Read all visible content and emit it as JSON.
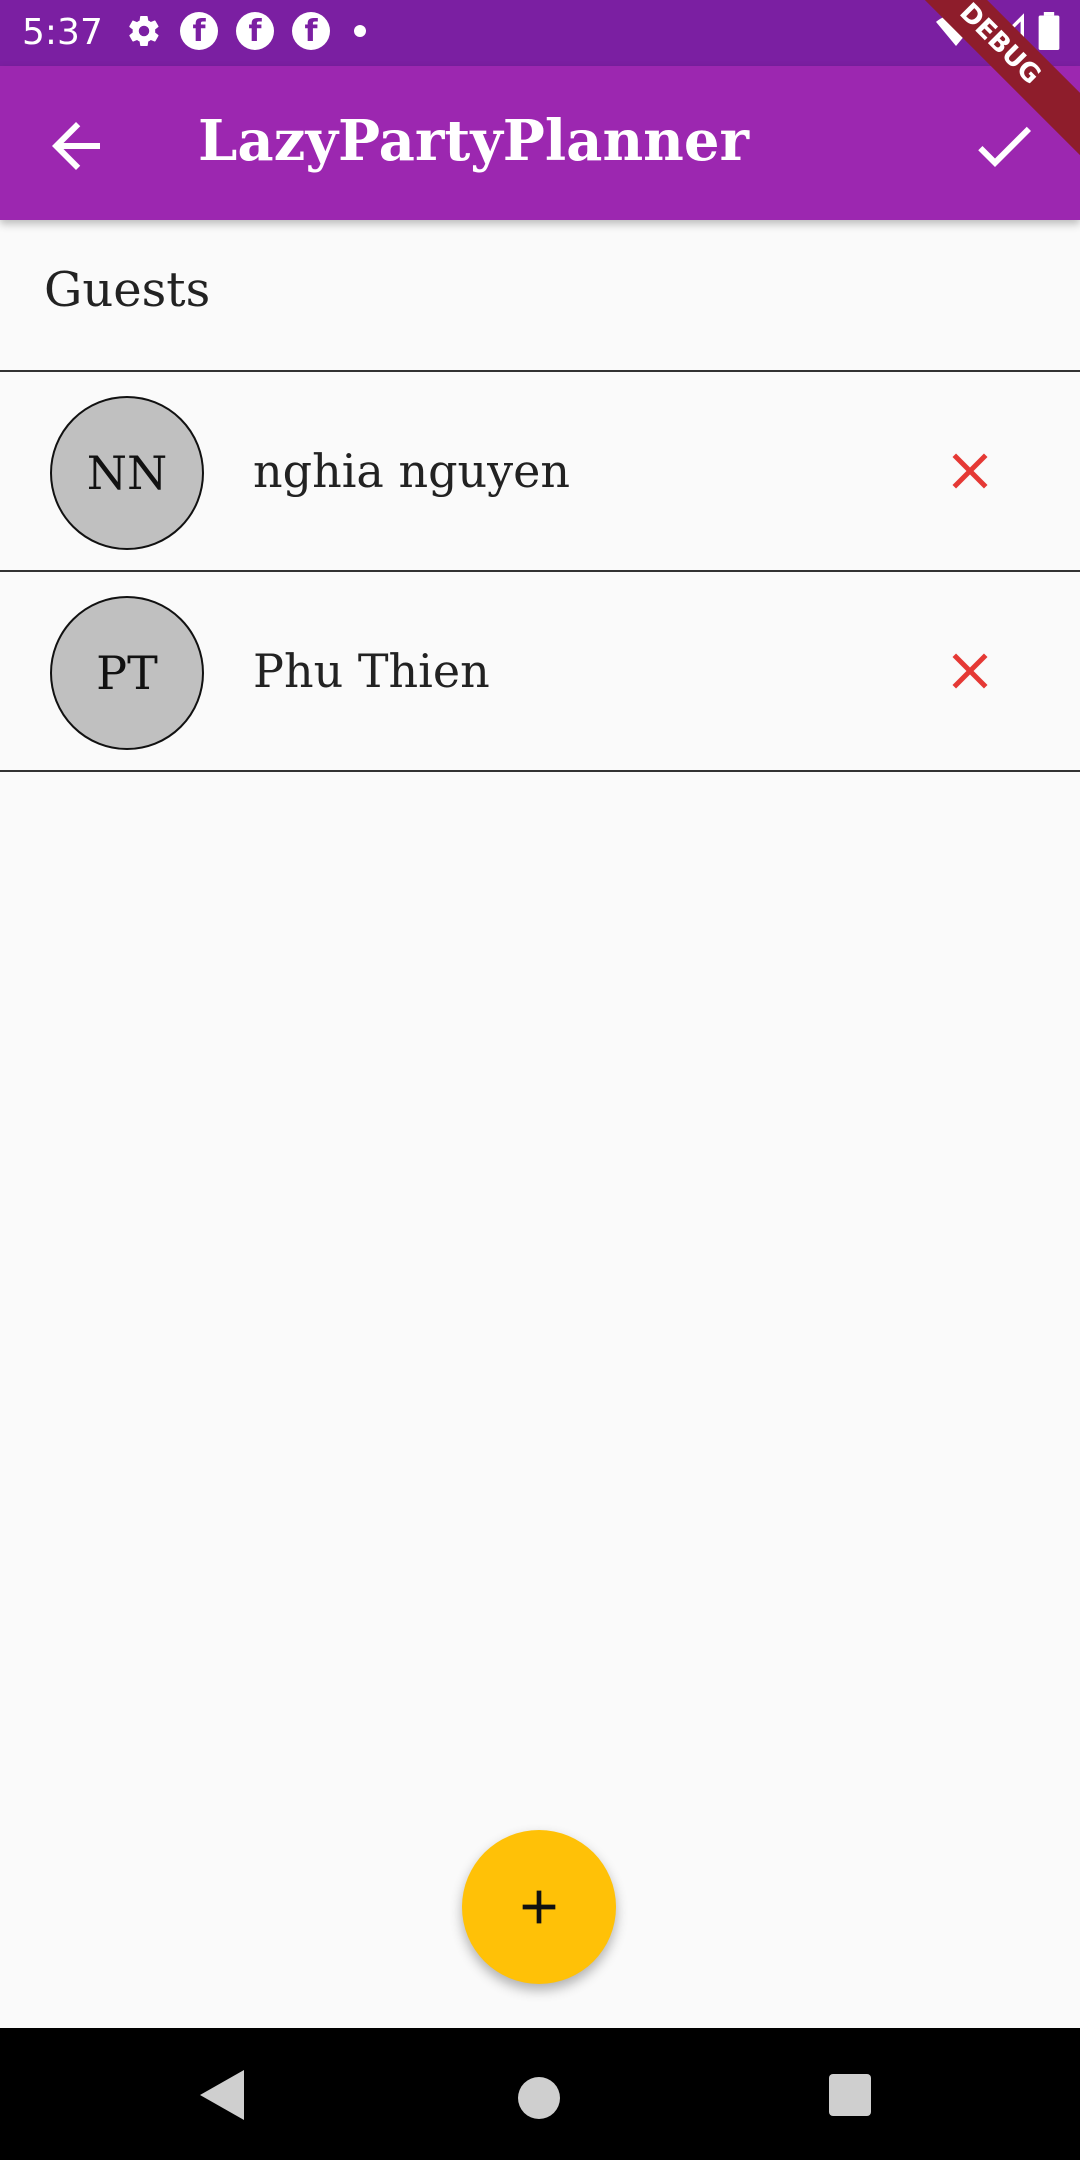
{
  "status_bar": {
    "time": "5:37",
    "icons": [
      "gear-icon",
      "facebook-icon",
      "facebook-icon",
      "facebook-icon",
      "dot-icon"
    ],
    "right_icons": [
      "wifi-icon",
      "signal-icon",
      "battery-icon"
    ]
  },
  "app_bar": {
    "title": "LazyPartyPlanner",
    "back_icon": "arrow-back-icon",
    "confirm_icon": "check-icon",
    "background": "#9c27b0"
  },
  "debug_banner": {
    "label": "DEBUG",
    "color": "#8e1d2b"
  },
  "section": {
    "title": "Guests"
  },
  "guests": [
    {
      "initials": "NN",
      "name": "nghia nguyen"
    },
    {
      "initials": "PT",
      "name": "Phu Thien"
    }
  ],
  "remove_icon": {
    "name": "close-icon",
    "color": "#e53935"
  },
  "fab": {
    "icon": "plus-icon",
    "color": "#ffc107"
  },
  "nav_bar": {
    "icons": [
      "nav-back-icon",
      "nav-home-icon",
      "nav-recents-icon"
    ]
  }
}
